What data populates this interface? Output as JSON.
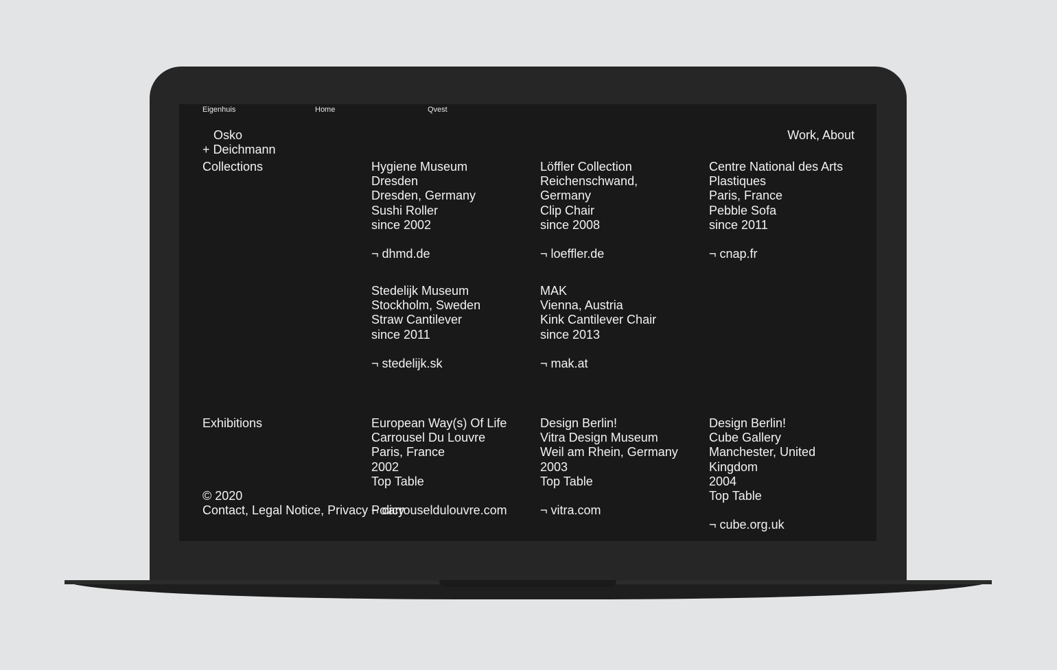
{
  "topnav": [
    "Eigenhuis",
    "Home",
    "Qvest"
  ],
  "brand": {
    "line1": "Osko",
    "line2": "+ Deichmann"
  },
  "mainnav": "Work, About",
  "collections": {
    "heading": "Collections",
    "items": [
      {
        "lines": [
          "Hygiene Museum",
          "Dresden",
          "Dresden, Germany",
          "Sushi Roller",
          "since 2002"
        ],
        "link": "¬ dhmd.de"
      },
      {
        "lines": [
          "Löffler Collection",
          "Reichenschwand,",
          "Germany",
          "Clip Chair",
          "since 2008"
        ],
        "link": "¬ loeffler.de"
      },
      {
        "lines": [
          "Centre National des Arts",
          "Plastiques",
          "Paris, France",
          "Pebble Sofa",
          "since 2011"
        ],
        "link": "¬ cnap.fr"
      },
      {
        "lines": [
          "Stedelijk Museum",
          "Stockholm, Sweden",
          "Straw Cantilever",
          "since 2011"
        ],
        "link": "¬ stedelijk.sk"
      },
      {
        "lines": [
          "MAK",
          "Vienna, Austria",
          "Kink Cantilever Chair",
          "since 2013"
        ],
        "link": "¬ mak.at"
      }
    ]
  },
  "exhibitions": {
    "heading": "Exhibitions",
    "items": [
      {
        "lines": [
          "European Way(s) Of Life",
          "Carrousel Du Louvre",
          "Paris, France",
          "2002",
          "Top Table"
        ],
        "link": "¬ carrouseldulouvre.com"
      },
      {
        "lines": [
          "Design Berlin!",
          "Vitra Design Museum",
          "Weil am Rhein, Germany",
          "2003",
          "Top Table"
        ],
        "link": "¬ vitra.com"
      },
      {
        "lines": [
          "Design Berlin!",
          "Cube Gallery",
          "Manchester, United",
          "Kingdom",
          "2004",
          "Top Table"
        ],
        "link": "¬ cube.org.uk"
      }
    ]
  },
  "footer": {
    "copyright": "© 2020",
    "links": "Contact, Legal Notice, Privacy Policy"
  },
  "colors": {
    "page_bg": "#e3e4e6",
    "screen_bg": "#191919",
    "text": "#f2f2f2",
    "device": "#262626"
  }
}
